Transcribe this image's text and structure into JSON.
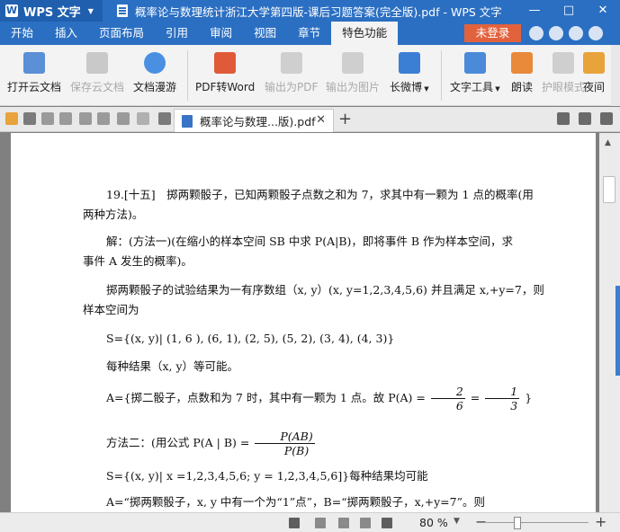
{
  "titlebar": {
    "app_name": "WPS 文字",
    "doc_title": "概率论与数理统计浙江大学第四版-课后习题答案(完全版).pdf - WPS 文字",
    "minimize": "—",
    "maximize": "□",
    "close": "✕"
  },
  "menu": {
    "items": [
      "开始",
      "插入",
      "页面布局",
      "引用",
      "审阅",
      "视图",
      "章节",
      "特色功能"
    ],
    "active": "特色功能",
    "login": "未登录"
  },
  "ribbon": {
    "buttons": [
      {
        "label": "打开云文档",
        "icon": "cloud-open-icon",
        "enabled": true
      },
      {
        "label": "保存云文档",
        "icon": "cloud-save-icon",
        "enabled": false
      },
      {
        "label": "文档漫游",
        "icon": "cloud-roam-icon",
        "enabled": true
      },
      {
        "label": "PDF转Word",
        "icon": "pdf-to-word-icon",
        "enabled": true
      },
      {
        "label": "输出为PDF",
        "icon": "export-pdf-icon",
        "enabled": false
      },
      {
        "label": "输出为图片",
        "icon": "export-image-icon",
        "enabled": false
      },
      {
        "label": "长微博",
        "icon": "weibo-icon",
        "enabled": true
      },
      {
        "label": "文字工具",
        "icon": "text-tools-icon",
        "enabled": true
      },
      {
        "label": "朗读",
        "icon": "read-aloud-icon",
        "enabled": true
      },
      {
        "label": "护眼模式",
        "icon": "eye-care-icon",
        "enabled": false
      },
      {
        "label": "夜间",
        "icon": "night-mode-icon",
        "enabled": true
      }
    ]
  },
  "tabs": {
    "doc_tab": "概率论与数理...版).pdf",
    "close": "✕",
    "new": "+"
  },
  "document": {
    "l1": "19.[十五]　掷两颗骰子，已知两颗骰子点数之和为 7，求其中有一颗为 1 点的概率(用",
    "l2": "两种方法)。",
    "l3": "解：(方法一)(在缩小的样本空间 SB 中求 P(A|B)，即将事件 B 作为样本空间，求",
    "l4": "事件 A 发生的概率)。",
    "l5": "掷两颗骰子的试验结果为一有序数组（x, y）(x, y=1,2,3,4,5,6) 并且满足 x,+y=7，则",
    "l6": "样本空间为",
    "l7": "S={(x, y)| (1, 6 ), (6, 1), (2, 5), (5, 2), (3, 4), (4, 3)}",
    "l8": "每种结果（x, y）等可能。",
    "l9a": "A={掷二骰子，点数和为 7 时，其中有一颗为 1 点。故 P(A) =",
    "l9_f1n": "2",
    "l9_f1d": "6",
    "l9_eq": "=",
    "l9_f2n": "1",
    "l9_f2d": "3",
    "l9b": "}",
    "l10a": "方法二：(用公式 P(A | B) =",
    "l10_fn": "P(AB)",
    "l10_fd": "P(B)",
    "l11": "S={(x, y)| x =1,2,3,4,5,6; y = 1,2,3,4,5,6]}每种结果均可能",
    "l12": "A=“掷两颗骰子，x, y 中有一个为“1”点”，B=“掷两颗骰子，x,+y=7”。则"
  },
  "status": {
    "zoom": "80 %",
    "zoom_value": 0.8,
    "minus": "−",
    "plus": "+"
  },
  "colors": {
    "titlebar": "#2b6fc2",
    "login": "#e2623d",
    "ribbon": "#f3f3f3"
  }
}
